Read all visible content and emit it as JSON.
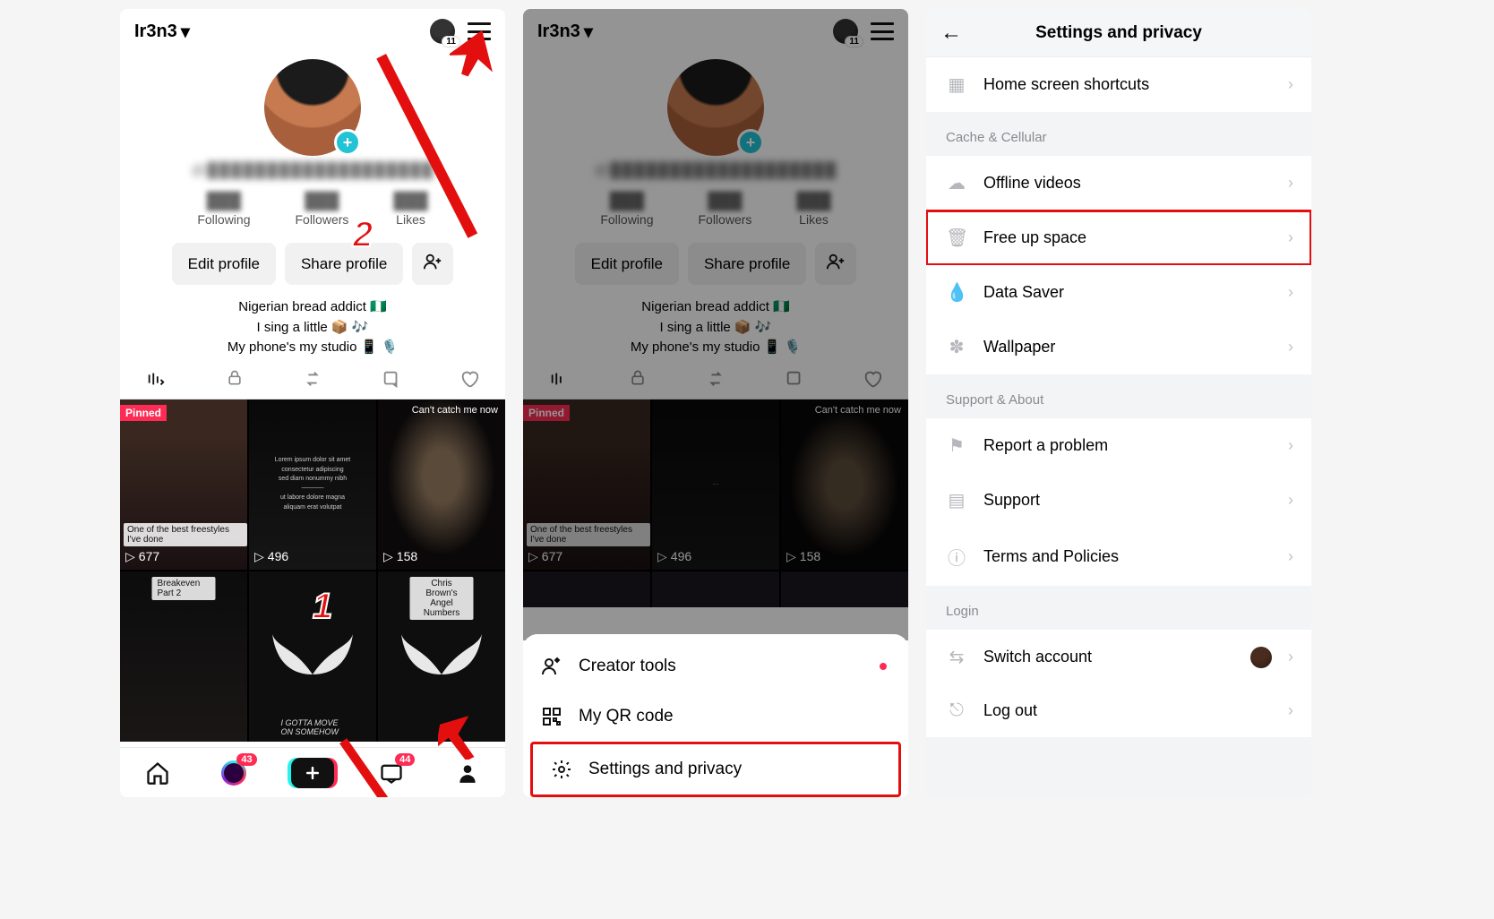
{
  "panel1": {
    "header": {
      "username": "Ir3n3",
      "badge_count": "11"
    },
    "username_sub": "@███████████████████",
    "stats": [
      {
        "num": "███",
        "label": "Following"
      },
      {
        "num": "███",
        "label": "Followers"
      },
      {
        "num": "███",
        "label": "Likes"
      }
    ],
    "buttons": {
      "edit": "Edit profile",
      "share": "Share profile"
    },
    "bio_line1": "Nigerian bread addict 🇳🇬",
    "bio_line2": "I sing a little 📦 🎶",
    "bio_line3": "My phone's my studio 📱 🎙️",
    "grid": [
      {
        "pinned": "Pinned",
        "caption": "One of the best freestyles I've done",
        "views": "677"
      },
      {
        "views": "496"
      },
      {
        "topcap": "Can't catch me now",
        "views": "158"
      },
      {
        "caption": "Breakeven Part 2"
      },
      {
        "caption": "I GOTTA MOVE ON SOMEHOW"
      },
      {
        "caption": "Chris Brown's Angel Numbers"
      }
    ],
    "bottom_tabs": {
      "friends_badge": "43",
      "inbox_badge": "44"
    },
    "annotation": {
      "step1": "1",
      "step2": "2"
    }
  },
  "panel2": {
    "header": {
      "username": "Ir3n3",
      "badge_count": "11"
    },
    "bio_line1": "Nigerian bread addict 🇳🇬",
    "bio_line2": "I sing a little 📦 🎶",
    "bio_line3": "My phone's my studio 📱 🎙️",
    "sheet": {
      "creator_tools": "Creator tools",
      "my_qr": "My QR code",
      "settings": "Settings and privacy"
    }
  },
  "panel3": {
    "title": "Settings and privacy",
    "groups": {
      "first_item": "Home screen shortcuts",
      "cache_title": "Cache & Cellular",
      "cache_items": [
        "Offline videos",
        "Free up space",
        "Data Saver",
        "Wallpaper"
      ],
      "support_title": "Support & About",
      "support_items": [
        "Report a problem",
        "Support",
        "Terms and Policies"
      ],
      "login_title": "Login",
      "login_items": [
        "Switch account",
        "Log out"
      ]
    }
  }
}
